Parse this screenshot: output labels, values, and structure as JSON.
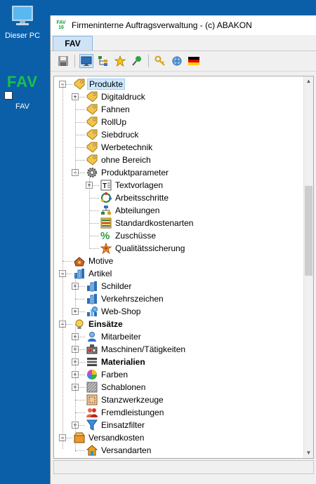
{
  "desktop": {
    "pc_label": "Dieser PC",
    "fav_logo": "FAV",
    "fav_label": "FAV"
  },
  "window": {
    "title": "Firmeninterne Auftragsverwaltung - (c) ABAKON",
    "app_icon_top": "FAV",
    "app_icon_bottom": "16",
    "tab_label": "FAV"
  },
  "toolbar": {
    "icons": [
      "save-icon",
      "monitor-icon",
      "tree-icon",
      "star-icon",
      "pin-icon",
      "key-icon",
      "network-icon",
      "german-flag-icon"
    ]
  },
  "tree": {
    "items": [
      {
        "label": "Produkte",
        "icon": "tag"
      },
      {
        "label": "Digitaldruck",
        "icon": "tag"
      },
      {
        "label": "Fahnen",
        "icon": "tag"
      },
      {
        "label": "RollUp",
        "icon": "tag"
      },
      {
        "label": "Siebdruck",
        "icon": "tag"
      },
      {
        "label": "Werbetechnik",
        "icon": "tag"
      },
      {
        "label": "ohne Bereich",
        "icon": "tag"
      },
      {
        "label": "Produktparameter",
        "icon": "gear"
      },
      {
        "label": "Textvorlagen",
        "icon": "text"
      },
      {
        "label": "Arbeitsschritte",
        "icon": "steps"
      },
      {
        "label": "Abteilungen",
        "icon": "org"
      },
      {
        "label": "Standardkostenarten",
        "icon": "list"
      },
      {
        "label": "Zuschüsse",
        "icon": "percent"
      },
      {
        "label": "Qualitätssicherung",
        "icon": "quality"
      },
      {
        "label": "Motive",
        "icon": "motive"
      },
      {
        "label": "Artikel",
        "icon": "article"
      },
      {
        "label": "Schilder",
        "icon": "article"
      },
      {
        "label": "Verkehrszeichen",
        "icon": "article"
      },
      {
        "label": "Web-Shop",
        "icon": "webshop"
      },
      {
        "label": "Einsätze",
        "icon": "bulb"
      },
      {
        "label": "Mitarbeiter",
        "icon": "person"
      },
      {
        "label": "Maschinen/Tätigkeiten",
        "icon": "machine"
      },
      {
        "label": "Materialien",
        "icon": "material"
      },
      {
        "label": "Farben",
        "icon": "color"
      },
      {
        "label": "Schablonen",
        "icon": "pattern"
      },
      {
        "label": "Stanzwerkzeuge",
        "icon": "stamp"
      },
      {
        "label": "Fremdleistungen",
        "icon": "people"
      },
      {
        "label": "Einsatzfilter",
        "icon": "filter"
      },
      {
        "label": "Versandkosten",
        "icon": "box"
      },
      {
        "label": "Versandarten",
        "icon": "house"
      }
    ]
  }
}
